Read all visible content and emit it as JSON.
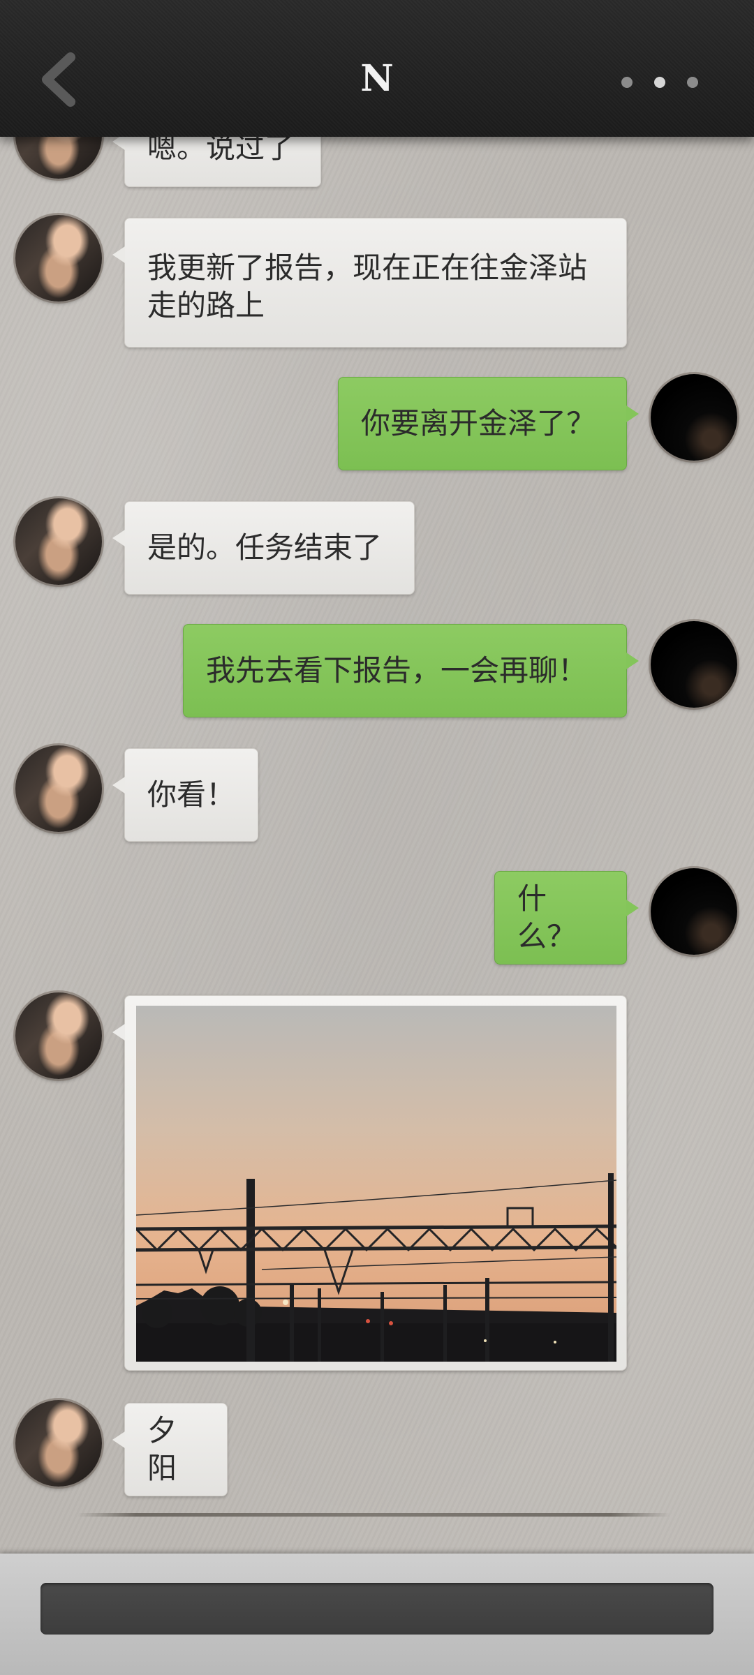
{
  "header": {
    "title": "N",
    "back_icon": "chevron-left-icon",
    "more_icon": "more-dots-icon"
  },
  "messages": [
    {
      "sender": "N",
      "text": "嗯。说过了"
    },
    {
      "sender": "N",
      "text": "我更新了报告，现在正在往金泽站走的路上"
    },
    {
      "sender": "me",
      "text": "你要离开金泽了？"
    },
    {
      "sender": "N",
      "text": "是的。任务结束了"
    },
    {
      "sender": "me",
      "text": "我先去看下报告，一会再聊！"
    },
    {
      "sender": "N",
      "text": "你看！"
    },
    {
      "sender": "me",
      "text": "什么？"
    },
    {
      "sender": "N",
      "type": "image",
      "image": "sunset-railway-photo"
    },
    {
      "sender": "N",
      "text": "夕阳"
    }
  ],
  "input": {
    "placeholder": ""
  },
  "colors": {
    "right_bubble": "#84c55a",
    "left_bubble": "#ebeae7",
    "header": "#222222"
  }
}
